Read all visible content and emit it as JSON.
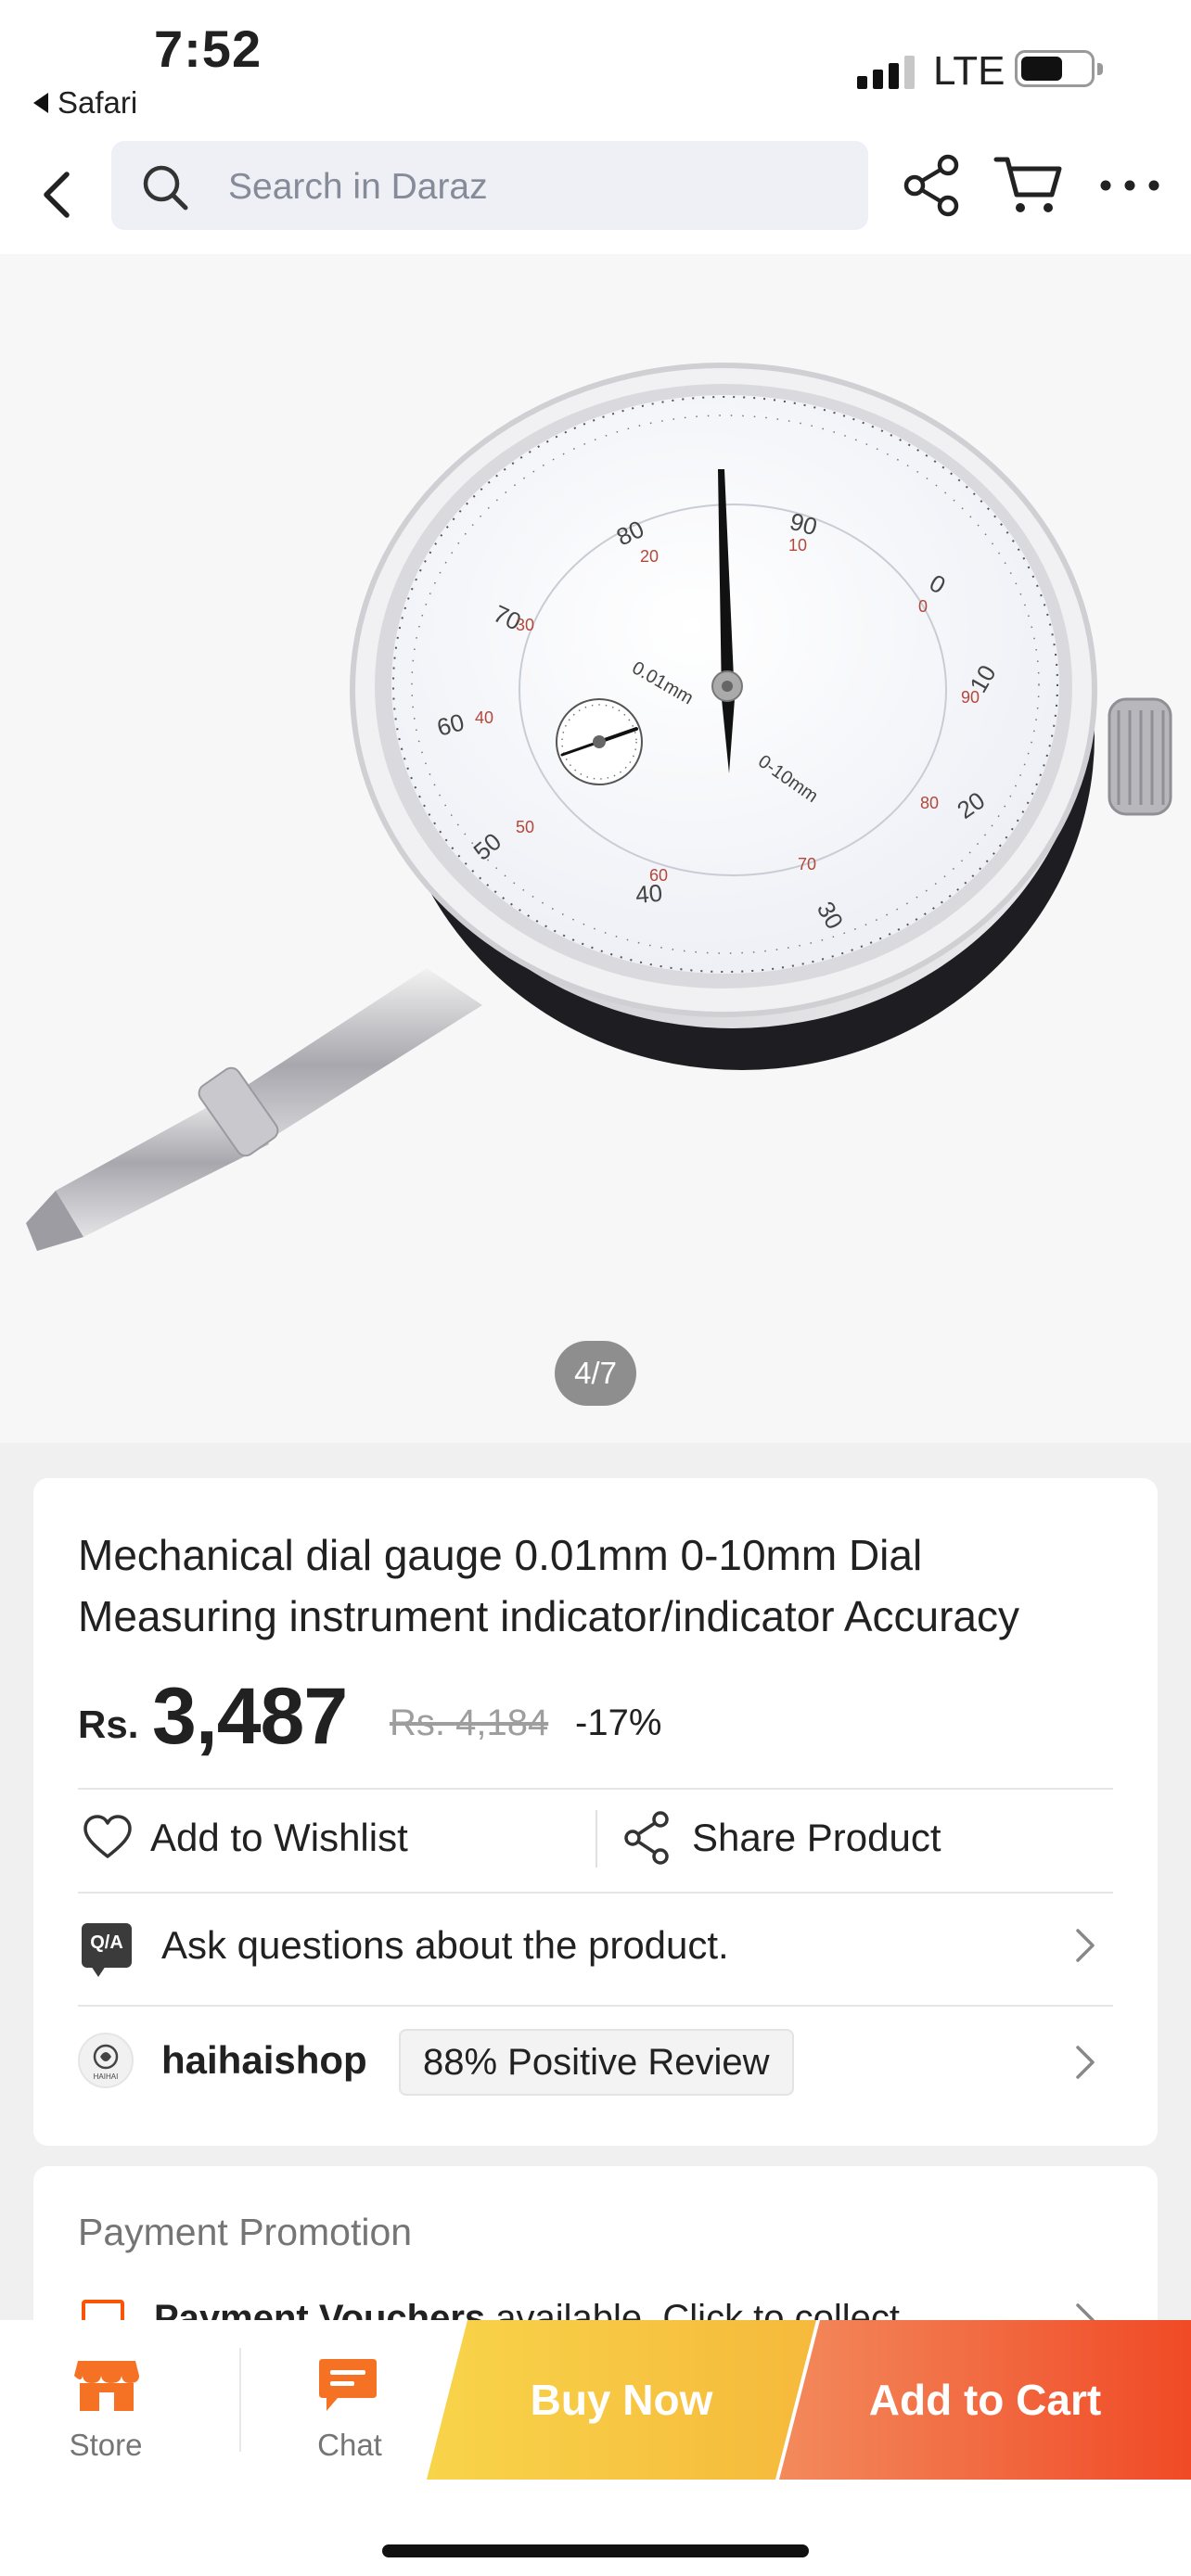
{
  "status_bar": {
    "time": "7:52",
    "back_app": "Safari",
    "network": "LTE"
  },
  "header": {
    "search_placeholder": "Search in Daraz"
  },
  "gallery": {
    "counter": "4/7"
  },
  "product": {
    "title_line1": "Mechanical dial gauge 0.01mm 0-10mm Dial",
    "title_line2": "Measuring instrument indicator/indicator Accuracy",
    "currency": "Rs.",
    "price": "3,487",
    "old_price": "Rs. 4,184",
    "discount": "-17%",
    "wishlist_label": "Add to Wishlist",
    "share_label": "Share Product",
    "qa_badge": "Q/A",
    "qa_label": "Ask questions about the product.",
    "seller": {
      "logo_text": "HAIHAI",
      "name": "haihaishop",
      "review": "88% Positive Review"
    }
  },
  "payment": {
    "title": "Payment Promotion",
    "row_bold": "Payment Vouchers",
    "row_text": " available. Click to collect."
  },
  "bottom_bar": {
    "store": "Store",
    "chat": "Chat",
    "buy_now": "Buy Now",
    "add_to_cart": "Add to Cart"
  },
  "colors": {
    "accent_orange": "#f85606",
    "buy_now": "#f6b93b",
    "add_to_cart": "#f04a26"
  },
  "icons": [
    "back-icon",
    "search-icon",
    "share-icon",
    "cart-icon",
    "more-icon",
    "heart-icon",
    "qa-icon",
    "chevron-right-icon",
    "store-icon",
    "chat-icon"
  ]
}
